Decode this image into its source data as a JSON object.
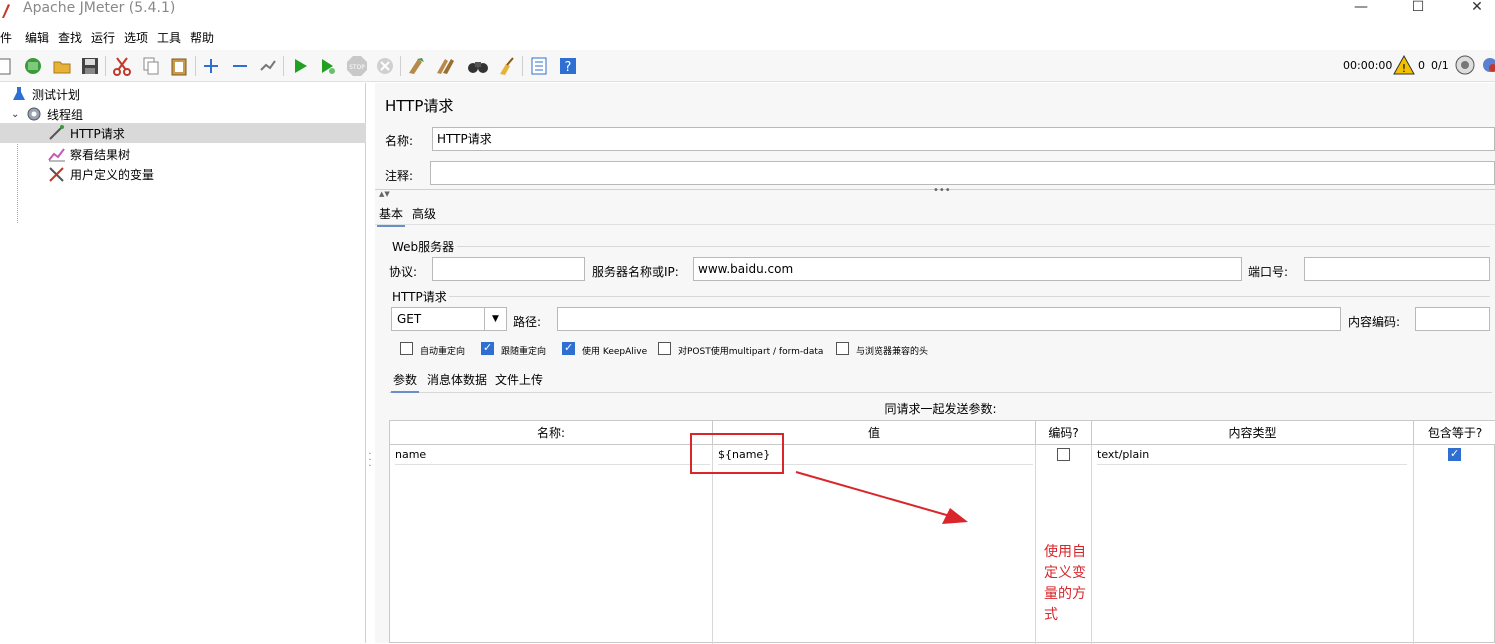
{
  "window": {
    "title": "Apache JMeter (5.4.1)",
    "min_glyph": "—",
    "max_glyph": "☐",
    "close_glyph": "✕"
  },
  "menu": [
    "文件",
    "编辑",
    "查找",
    "运行",
    "选项",
    "工具",
    "帮助"
  ],
  "toolbar": {
    "timer": "00:00:00",
    "warnings": "0",
    "threads": "0/1"
  },
  "tree": {
    "items": [
      {
        "label": "测试计划"
      },
      {
        "label": "线程组"
      },
      {
        "label": "HTTP请求"
      },
      {
        "label": "察看结果树"
      },
      {
        "label": "用户定义的变量"
      }
    ]
  },
  "panel": {
    "title": "HTTP请求",
    "name_label": "名称:",
    "name_value": "HTTP请求",
    "comment_label": "注释:",
    "comment_value": "",
    "tabs": [
      "基本",
      "高级"
    ],
    "web_server": {
      "group_label": "Web服务器",
      "protocol_label": "协议:",
      "protocol_value": "",
      "server_label": "服务器名称或IP:",
      "server_value": "www.baidu.com",
      "port_label": "端口号:",
      "port_value": ""
    },
    "http_request": {
      "group_label": "HTTP请求",
      "method": "GET",
      "path_label": "路径:",
      "path_value": "",
      "encoding_label": "内容编码:",
      "encoding_value": ""
    },
    "options": [
      {
        "label": "自动重定向",
        "checked": false
      },
      {
        "label": "跟随重定向",
        "checked": true
      },
      {
        "label": "使用 KeepAlive",
        "checked": true
      },
      {
        "label": "对POST使用multipart / form-data",
        "checked": false
      },
      {
        "label": "与浏览器兼容的头",
        "checked": false
      }
    ],
    "sub_tabs": [
      "参数",
      "消息体数据",
      "文件上传"
    ],
    "params_caption": "同请求一起发送参数:",
    "columns": [
      "名称:",
      "值",
      "编码?",
      "内容类型",
      "包含等于?"
    ],
    "rows": [
      {
        "name": "name",
        "value": "${name}",
        "encode": false,
        "content_type": "text/plain",
        "include_equals": true
      }
    ]
  },
  "annotation": {
    "text": "使用自定义变量的方式",
    "color": "#d9262b"
  }
}
